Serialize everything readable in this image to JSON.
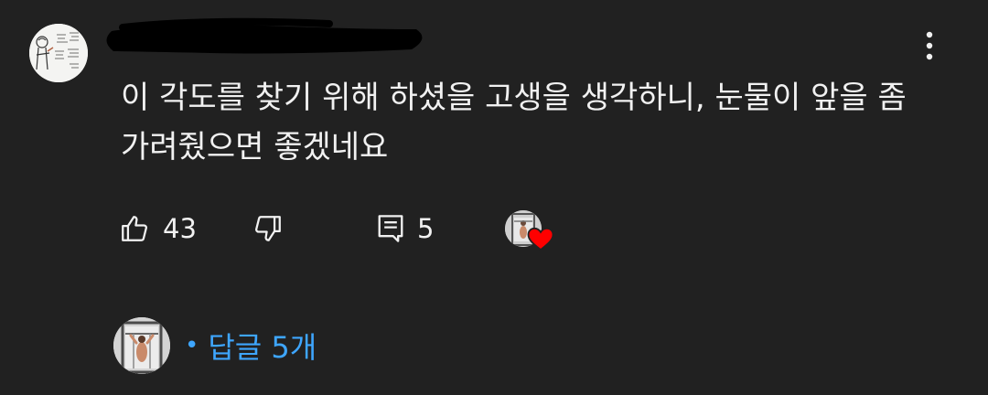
{
  "comment": {
    "author_name": "",
    "text": "이 각도를 찾기 위해 하셨을 고생을 생각하니, 눈물이 앞을 좀 가려줬으면 좋겠네요",
    "like_count": "43",
    "reply_count": "5"
  },
  "icons": {
    "like": "thumb-up-icon",
    "dislike": "thumb-down-icon",
    "reply": "comment-icon",
    "menu": "more-vert-icon",
    "heart": "heart-icon"
  },
  "replies": {
    "label": "답글 5개",
    "dot": "•"
  },
  "colors": {
    "background": "#212121",
    "text": "#f1f1f1",
    "link": "#3ea6ff",
    "heart": "#ff0000"
  }
}
